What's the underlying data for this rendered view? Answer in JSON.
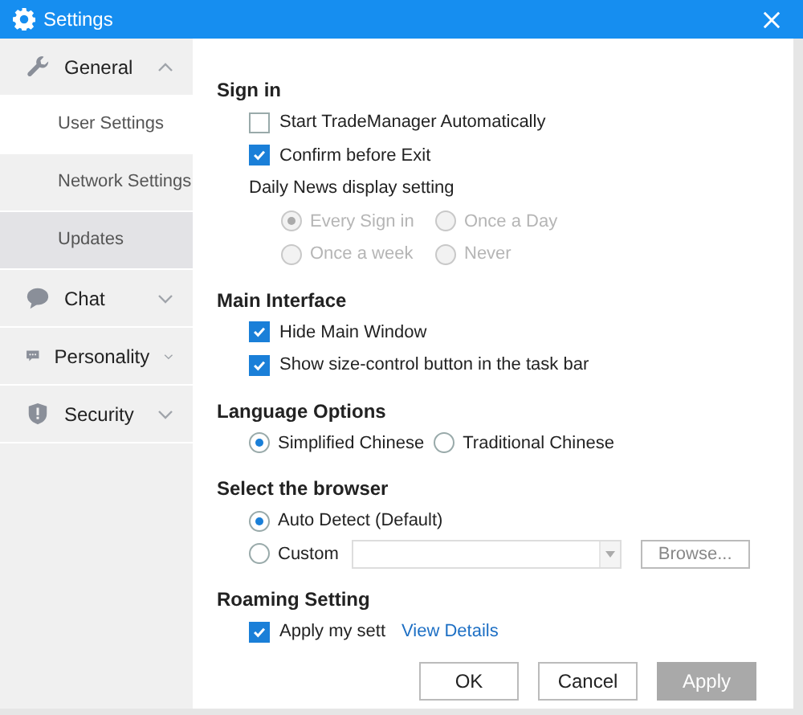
{
  "window": {
    "title": "Settings"
  },
  "sidebar": [
    {
      "label": "General",
      "expanded": true,
      "children": [
        {
          "label": "User Settings",
          "selected": true,
          "highlighted": false
        },
        {
          "label": "Network Settings",
          "selected": false,
          "highlighted": false
        },
        {
          "label": "Updates",
          "selected": false,
          "highlighted": true
        }
      ]
    },
    {
      "label": "Chat",
      "expanded": false
    },
    {
      "label": "Personality",
      "expanded": false
    },
    {
      "label": "Security",
      "expanded": false
    }
  ],
  "sections": [
    {
      "title": "Sign in",
      "rows": [
        {
          "kind": "checkbox",
          "label": "Start TradeManager Automatically",
          "checked": false
        },
        {
          "kind": "checkbox",
          "label": "Confirm before Exit",
          "checked": true
        },
        {
          "kind": "text",
          "label": "Daily News display setting"
        },
        {
          "kind": "radio_grid",
          "disabled": true,
          "options": [
            {
              "label": "Every Sign in",
              "selected": true
            },
            {
              "label": "Once a Day",
              "selected": false
            },
            {
              "label": "Once a week",
              "selected": false
            },
            {
              "label": "Never",
              "selected": false
            }
          ]
        }
      ]
    },
    {
      "title": "Main Interface",
      "rows": [
        {
          "kind": "checkbox",
          "label": "Hide Main Window",
          "checked": true
        },
        {
          "kind": "checkbox",
          "label": "Show size-control button in the task bar",
          "checked": true
        }
      ]
    },
    {
      "title": "Language Options",
      "rows": [
        {
          "kind": "radio_inline",
          "disabled": false,
          "options": [
            {
              "label": "Simplified Chinese",
              "selected": true
            },
            {
              "label": "Traditional Chinese",
              "selected": false
            }
          ]
        }
      ]
    },
    {
      "title": "Select the browser",
      "rows": [
        {
          "kind": "radio_stack",
          "disabled": false,
          "options": [
            {
              "label": "Auto Detect (Default)",
              "selected": true
            }
          ]
        },
        {
          "kind": "custom_browser",
          "label": "Custom",
          "selected": false,
          "button": "Browse..."
        }
      ]
    },
    {
      "title": "Roaming Setting",
      "rows": [
        {
          "kind": "checkbox_link",
          "label": "Apply my sett",
          "checked": true,
          "link": "View Details"
        }
      ]
    }
  ],
  "buttons": [
    {
      "label": "OK",
      "disabled": false
    },
    {
      "label": "Cancel",
      "disabled": false
    },
    {
      "label": "Apply",
      "disabled": true
    }
  ]
}
